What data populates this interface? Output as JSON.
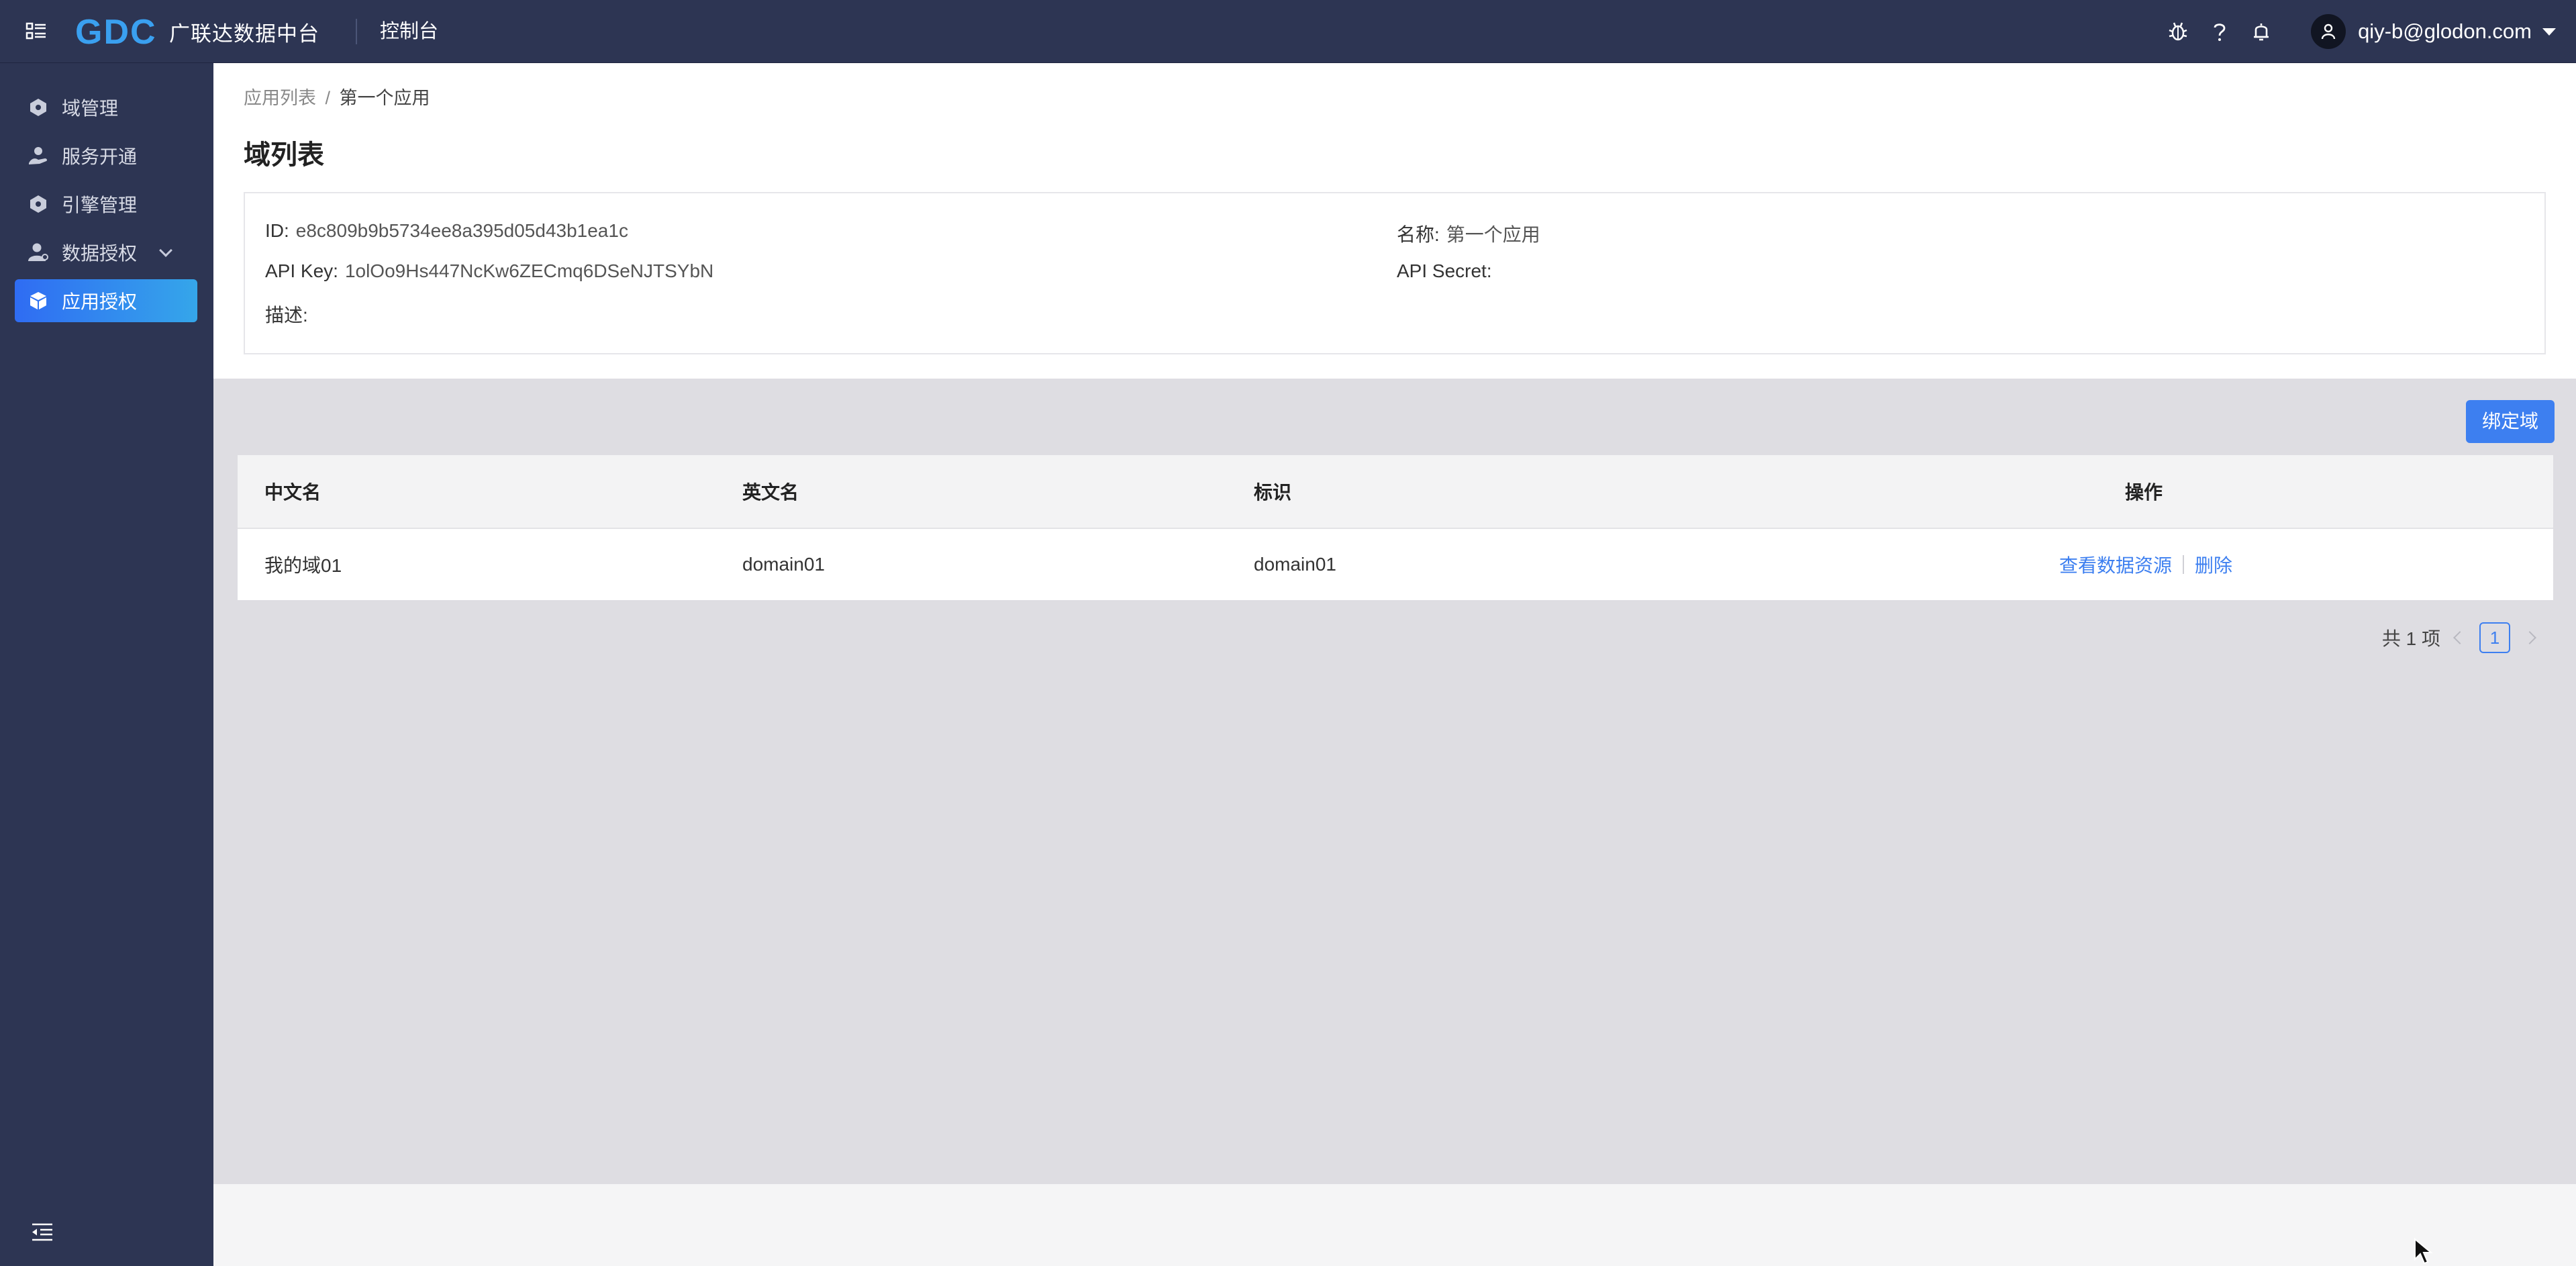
{
  "topbar": {
    "brand_logo_text": "GDC",
    "brand_name": "广联达数据中台",
    "console_label": "控制台",
    "user_name": "qiy-b@glodon.com",
    "colors": {
      "background": "#2d3553",
      "logo": "#3aa0f0"
    },
    "icons": [
      "menu-grid-icon",
      "bug-icon",
      "help-icon",
      "bell-icon",
      "user-avatar-icon",
      "caret-down-icon"
    ]
  },
  "sidebar": {
    "items": [
      {
        "label": "域管理",
        "icon": "hexagon-icon",
        "active": false
      },
      {
        "label": "服务开通",
        "icon": "user-hand-icon",
        "active": false
      },
      {
        "label": "引擎管理",
        "icon": "hexagon-icon",
        "active": false
      },
      {
        "label": "数据授权",
        "icon": "user-icon",
        "active": false,
        "expandable": true
      },
      {
        "label": "应用授权",
        "icon": "cube-icon",
        "active": true
      }
    ],
    "colors": {
      "active_from": "#2f6cf3",
      "active_to": "#35a6ea"
    }
  },
  "breadcrumb": {
    "parent": "应用列表",
    "separator": "/",
    "current": "第一个应用"
  },
  "page": {
    "title": "域列表"
  },
  "app_info": {
    "id_label": "ID:",
    "id_value": "e8c809b9b5734ee8a395d05d43b1ea1c",
    "name_label": "名称:",
    "name_value": "第一个应用",
    "api_key_label": "API Key:",
    "api_key_value": "1olOo9Hs447NcKw6ZECmq6DSeNJTSYbN",
    "api_secret_label": "API Secret:",
    "api_secret_value": "",
    "desc_label": "描述:",
    "desc_value": ""
  },
  "actions": {
    "bind_domain": "绑定域",
    "accent_color": "#3d7ff0"
  },
  "table": {
    "columns": [
      "中文名",
      "英文名",
      "标识",
      "操作"
    ],
    "rows": [
      {
        "cn_name": "我的域01",
        "en_name": "domain01",
        "identifier": "domain01",
        "ops": [
          "查看数据资源",
          "删除"
        ]
      }
    ]
  },
  "pagination": {
    "total_text": "共 1 项",
    "current_page": "1"
  }
}
